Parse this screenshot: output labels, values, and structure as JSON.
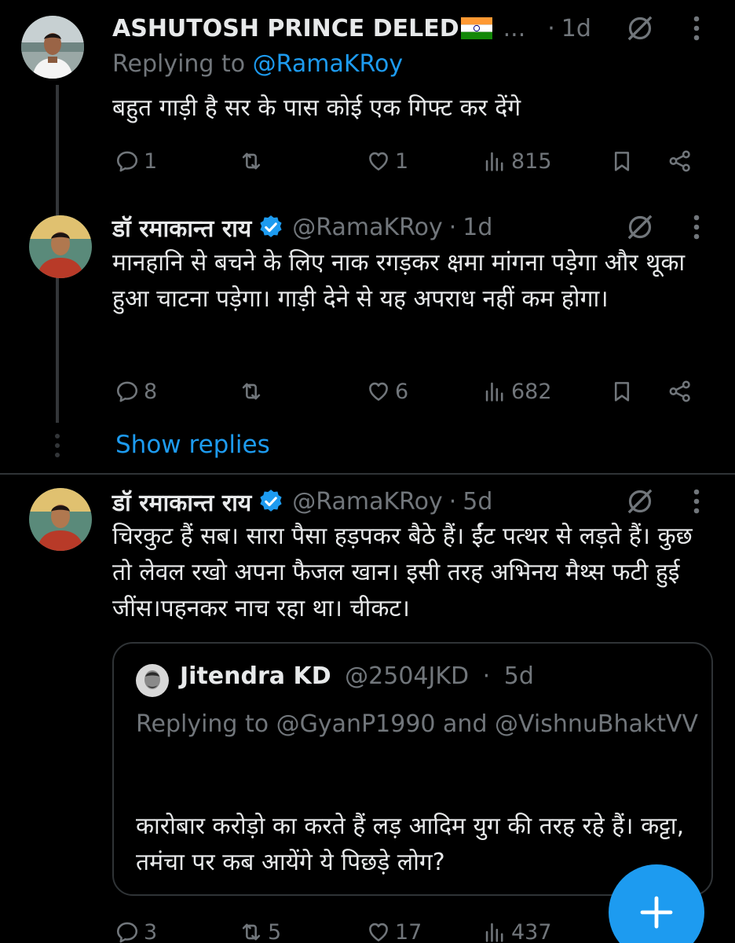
{
  "colors": {
    "background": "#000000",
    "text": "#e7e9ea",
    "muted": "#71767b",
    "accent": "#1d9bf0",
    "divider": "#2f3336"
  },
  "tweets": [
    {
      "name": "ASHUTOSH PRINCE DELED",
      "flag_icon": "india-flag-icon",
      "ellipsis": "...",
      "dot": "·",
      "time": "1d",
      "replying_prefix": "Replying to ",
      "replying_handle": "@RamaKRoy",
      "text": "बहुत गाड़ी है सर के पास कोई एक गिफ्ट कर देंगे",
      "replies": "1",
      "reposts": "",
      "likes": "1",
      "views": "815"
    },
    {
      "name": "डॉ रमाकान्त राय",
      "verified": true,
      "handle": "@RamaKRoy",
      "dot": "·",
      "time": "1d",
      "text": "मानहानि से बचने के लिए नाक रगड़कर क्षमा मांगना पड़ेगा और थूका हुआ चाटना पड़ेगा। गाड़ी देने से यह अपराध नहीं कम होगा।",
      "replies": "8",
      "reposts": "",
      "likes": "6",
      "views": "682"
    },
    {
      "name": "डॉ रमाकान्त राय",
      "verified": true,
      "handle": "@RamaKRoy",
      "dot": "·",
      "time": "5d",
      "text": "चिरकुट हैं सब। सारा पैसा हड़पकर बैठे हैं। ईंट पत्थर से लड़ते हैं। कुछ तो लेवल रखो अपना फैजल खान। इसी तरह अभिनय मैथ्स फटी हुई जींस।पहनकर नाच रहा था। चीकट।",
      "replies": "3",
      "reposts": "5",
      "likes": "17",
      "views": "437"
    }
  ],
  "show_replies": "Show replies",
  "quote": {
    "name": "Jitendra KD",
    "handle": "@2504JKD",
    "dot": "·",
    "time": "5d",
    "replying_prefix": "Replying to ",
    "replying_handle_1": "@GyanP1990",
    "replying_and": " and ",
    "replying_handle_2": "@VishnuBhaktVV",
    "text": "कारोबार करोड़ो का करते हैं लड़ आदिम युग की तरह रहे हैं। कट्टा, तमंचा पर कब आयेंगे ये पिछड़े लोग?"
  },
  "fab_icon": "plus-icon"
}
